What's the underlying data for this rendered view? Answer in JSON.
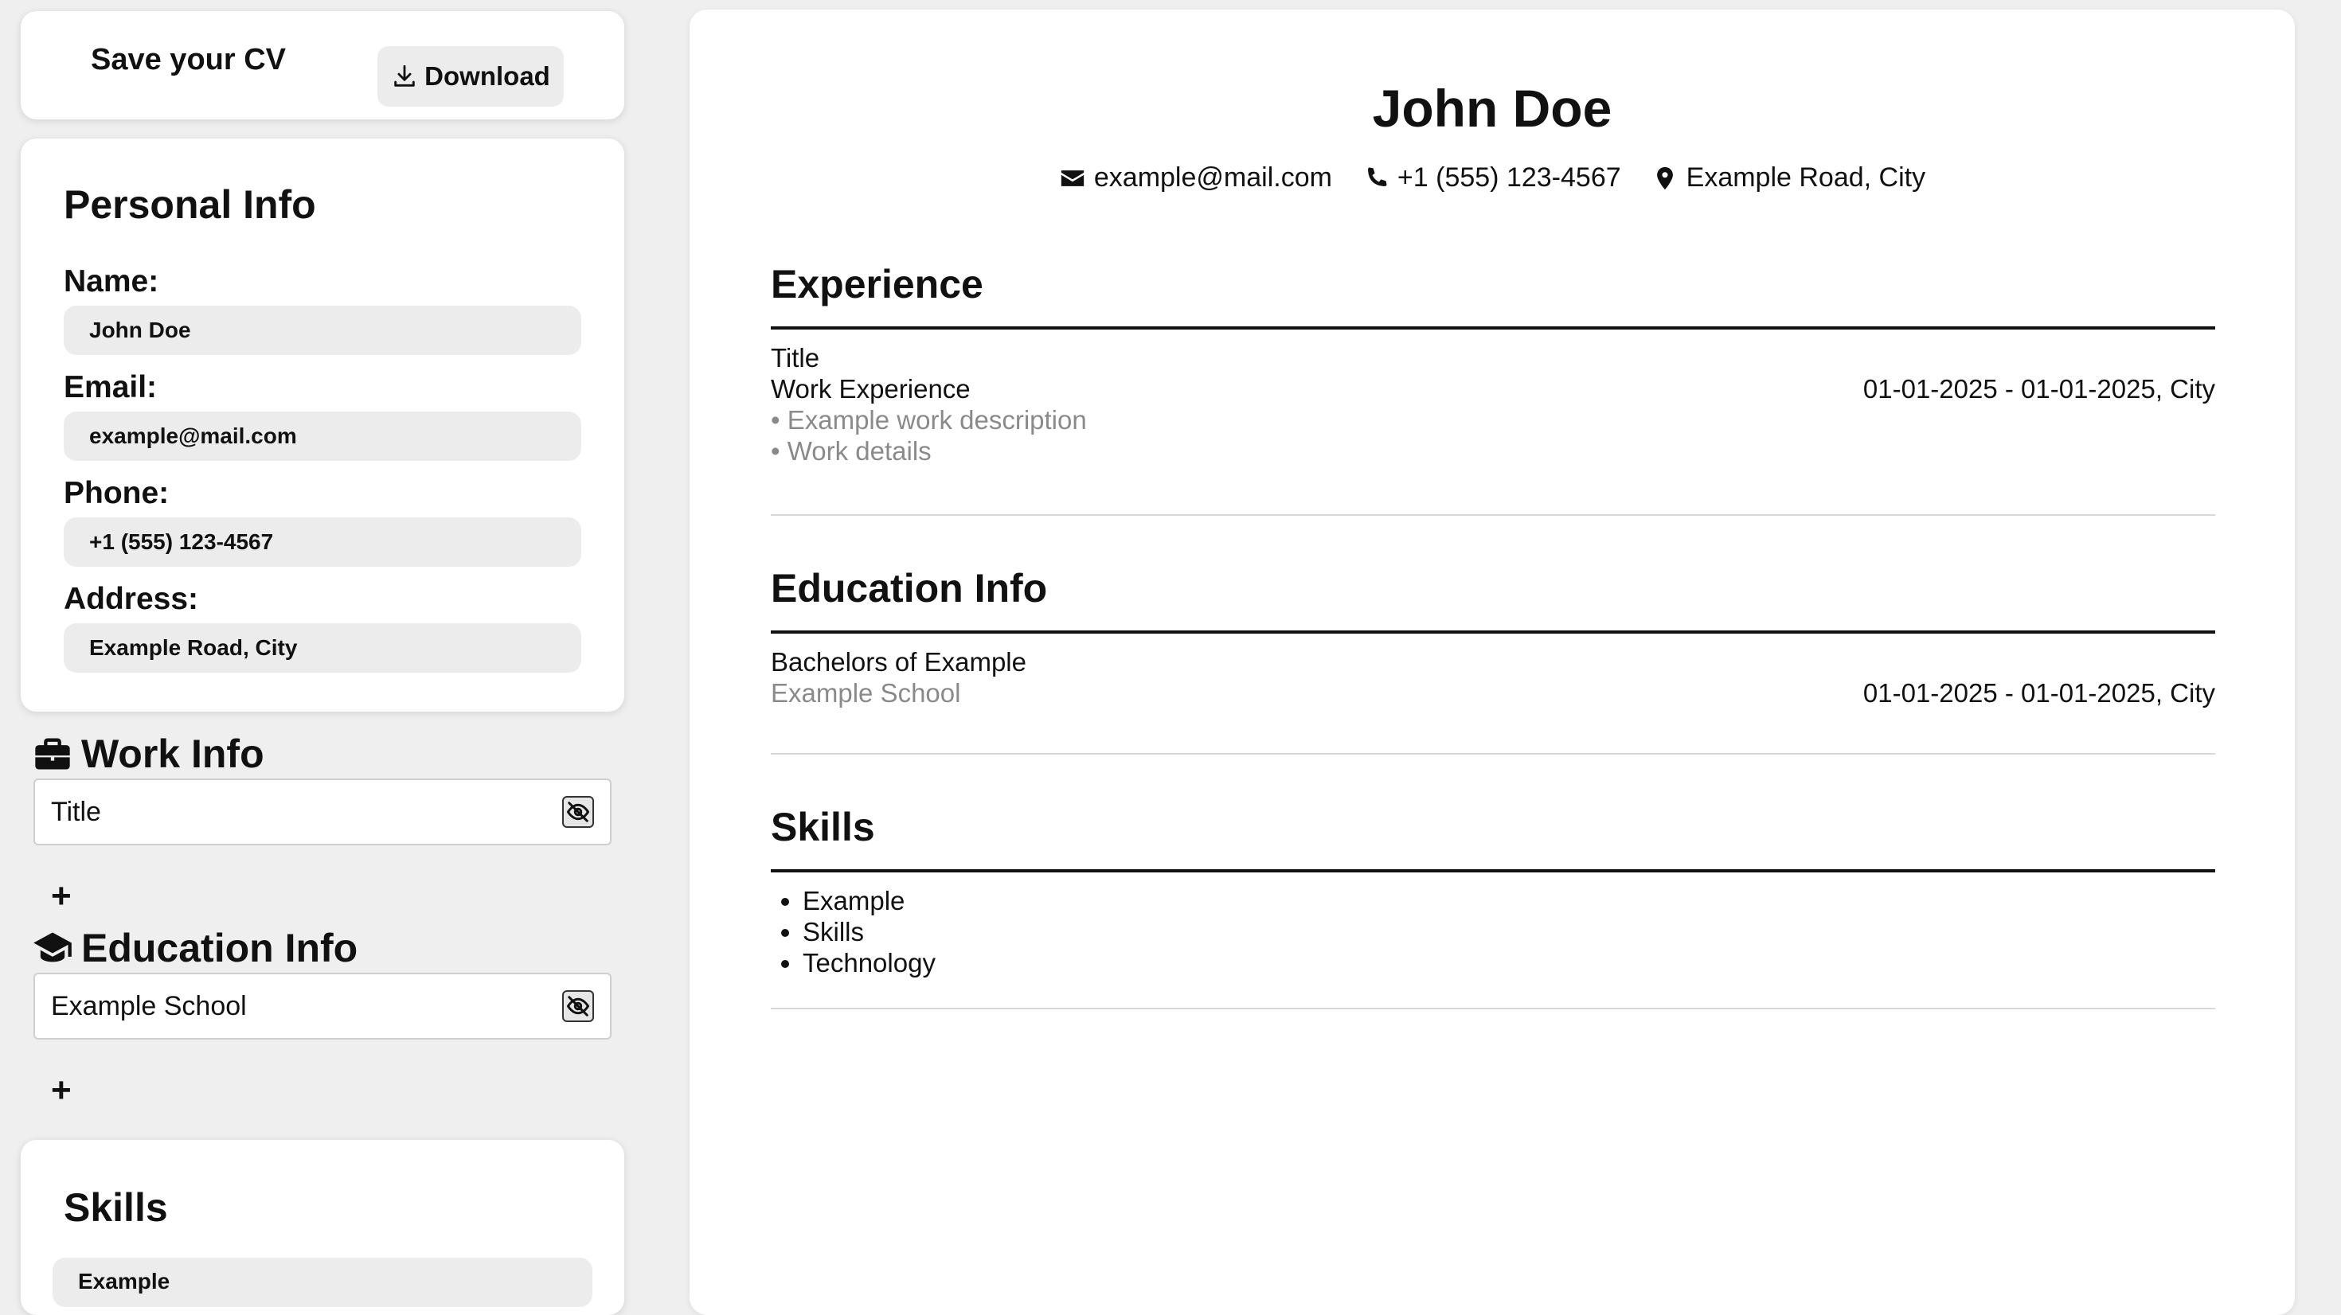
{
  "save_bar": {
    "title": "Save your CV",
    "download_label": "Download"
  },
  "personal": {
    "title": "Personal Info",
    "name_label": "Name:",
    "name_value": "John Doe",
    "email_label": "Email:",
    "email_value": "example@mail.com",
    "phone_label": "Phone:",
    "phone_value": "+1 (555) 123-4567",
    "address_label": "Address:",
    "address_value": "Example Road, City"
  },
  "work_info": {
    "title": "Work Info",
    "entries": [
      "Title"
    ],
    "add_label": "+"
  },
  "education_info": {
    "title": "Education Info",
    "entries": [
      "Example School"
    ],
    "add_label": "+"
  },
  "skills_panel": {
    "title": "Skills",
    "first_value": "Example"
  },
  "cv": {
    "name": "John Doe",
    "email": "example@mail.com",
    "phone": "+1 (555) 123-4567",
    "address": "Example Road, City",
    "experience": {
      "heading": "Experience",
      "title": "Title",
      "company": "Work Experience",
      "dates": "01-01-2025 - 01-01-2025, City",
      "bullets": [
        "• Example work description",
        "• Work details"
      ]
    },
    "education": {
      "heading": "Education Info",
      "degree": "Bachelors of Example",
      "school": "Example School",
      "dates": "01-01-2025 - 01-01-2025, City"
    },
    "skills": {
      "heading": "Skills",
      "items": [
        "Example",
        "Skills",
        "Technology"
      ]
    }
  }
}
